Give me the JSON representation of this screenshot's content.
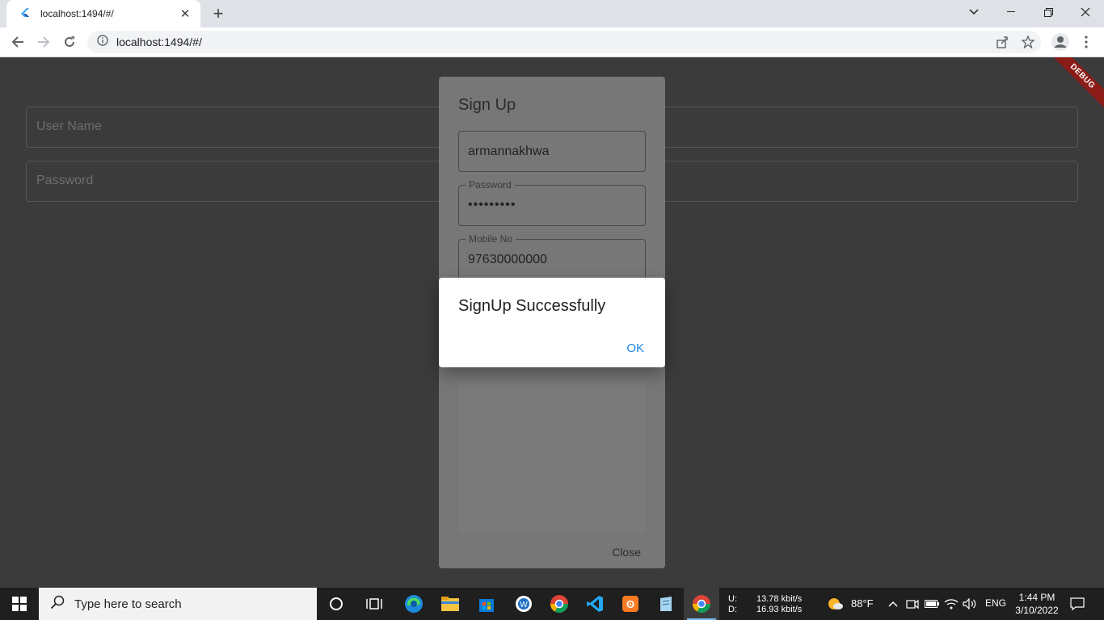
{
  "browser": {
    "tab_title": "localhost:1494/#/",
    "url": "localhost:1494/#/"
  },
  "page": {
    "username_placeholder": "User Name",
    "password_placeholder": "Password",
    "debug_banner": "DEBUG"
  },
  "signup_dialog": {
    "title": "Sign Up",
    "username_value": "armannakhwa",
    "password_label": "Password",
    "password_value": "•••••••••",
    "mobile_label": "Mobile No",
    "mobile_value": "97630000000",
    "close_label": "Close"
  },
  "alert": {
    "message": "SignUp Successfully",
    "ok_label": "OK"
  },
  "taskbar": {
    "search_placeholder": "Type here to search",
    "net_upload_label": "U:",
    "net_download_label": "D:",
    "net_upload": "13.78 kbit/s",
    "net_download": "16.93 kbit/s",
    "temperature": "88°F",
    "language": "ENG",
    "time": "1:44 PM",
    "date": "3/10/2022"
  },
  "colors": {
    "accent": "#1e88e5",
    "debug": "#8a1b17",
    "overlay_bg": "#3b3b3b"
  }
}
